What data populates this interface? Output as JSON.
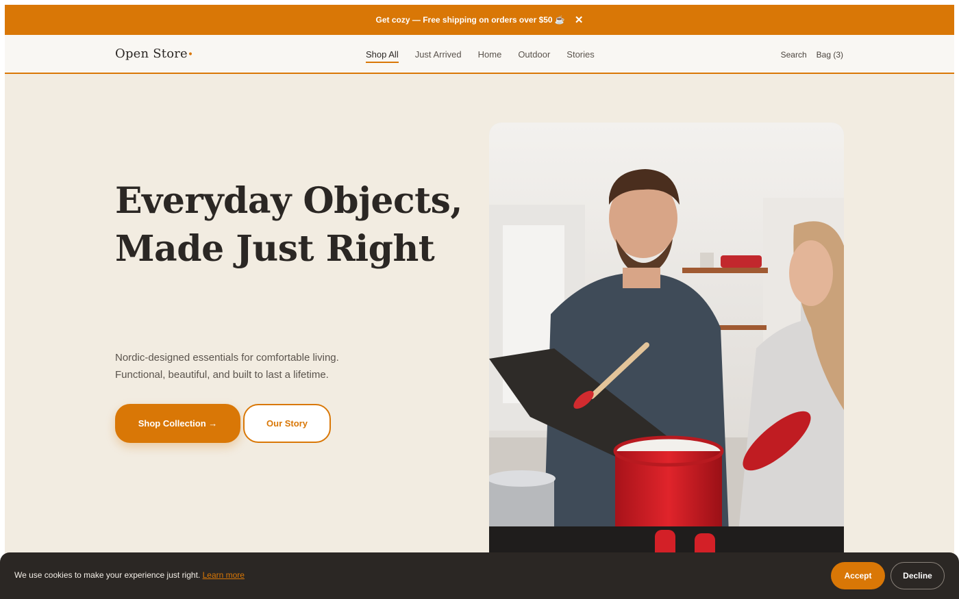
{
  "announcement": {
    "text": "Get cozy — Free shipping on orders over $50 ☕",
    "close_icon": "close-icon"
  },
  "header": {
    "logo": "Open Store",
    "logo_dot": "•",
    "nav": [
      {
        "label": "Shop All",
        "active": true
      },
      {
        "label": "Just Arrived",
        "active": false
      },
      {
        "label": "Home",
        "active": false
      },
      {
        "label": "Outdoor",
        "active": false
      },
      {
        "label": "Stories",
        "active": false
      }
    ],
    "search_label": "Search",
    "bag_label": "Bag (3)"
  },
  "hero": {
    "title_line1": "Everyday Objects,",
    "title_line2": "Made Just Right",
    "subtitle_line1": "Nordic-designed essentials for comfortable living.",
    "subtitle_line2": "Functional, beautiful, and built to last a lifetime.",
    "primary_button": "Shop Collection →",
    "secondary_button": "Our Story"
  },
  "cookie": {
    "text": "We use cookies to make your experience just right.",
    "link": "Learn more",
    "accept": "Accept",
    "decline": "Decline"
  },
  "colors": {
    "accent": "#d97706",
    "background": "#f2ece1",
    "header_bg": "#f9f7f3",
    "text_dark": "#2b2724",
    "cookie_bg": "#2b2724"
  }
}
